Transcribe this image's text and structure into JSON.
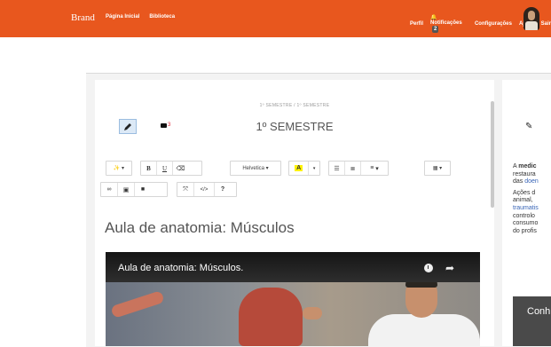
{
  "nav": {
    "brand": "Brand",
    "home": "Página Inicial",
    "library": "Biblioteca",
    "profile": "Perfil",
    "notifications": "Notificações",
    "notifications_count": "2",
    "settings": "Configurações",
    "help": "Ajuda",
    "logout": "Sair"
  },
  "header": {
    "breadcrumb": "1º SEMESTRE / 1º SEMESTRE",
    "title": "1º SEMESTRE",
    "comment_count": "3"
  },
  "toolbar": {
    "magic": "⚡",
    "bold": "B",
    "underline": "U",
    "eraser": "⌫",
    "font_name": "Helvetica",
    "highlight_letter": "A",
    "code": "</>",
    "help": "?"
  },
  "content": {
    "title": "Aula de anatomia: Músculos"
  },
  "video": {
    "title": "Aula de anatomia: Músculos."
  },
  "right_panel": {
    "line1_prefix": "A ",
    "line1_bold": "medic",
    "line2": "restaura",
    "line3_prefix": "das ",
    "line3_link": "doen",
    "p2_line1": "Ações d",
    "p2_line2": "animal, ",
    "p2_line3_link": "traumatis",
    "p2_line4": "controlo",
    "p2_line5": "consumo",
    "p2_line6": "do profis",
    "video_text": "Conh"
  }
}
